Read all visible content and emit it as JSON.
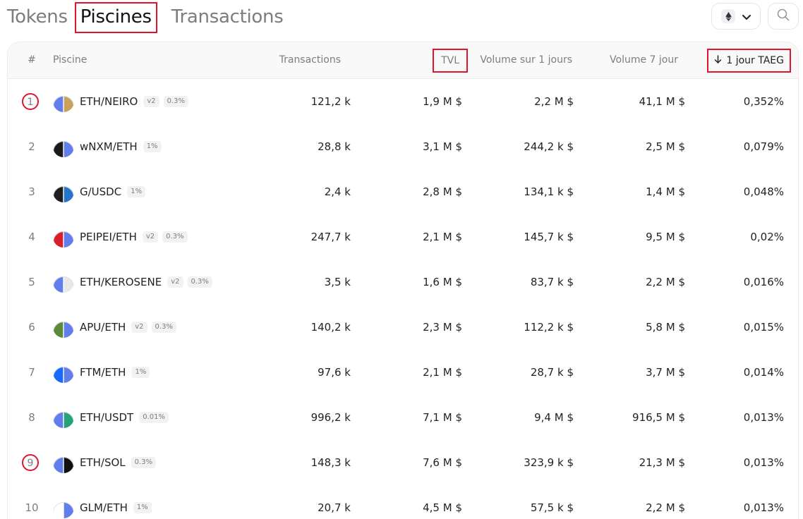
{
  "tabs": [
    "Tokens",
    "Piscines",
    "Transactions"
  ],
  "active_tab": "Piscines",
  "table": {
    "headers": {
      "num": "#",
      "pool": "Piscine",
      "tx": "Transactions",
      "tvl": "TVL",
      "vol1": "Volume sur 1 jours",
      "vol7": "Volume 7 jour",
      "apr": "1 jour TAEG"
    },
    "rows": [
      {
        "num": "1",
        "pair": "ETH/NEIRO",
        "badges": [
          "v2",
          "0.3%"
        ],
        "tx": "121,2 k",
        "tvl": "1,9 M $",
        "vol1": "2,2 M $",
        "vol7": "41,1 M $",
        "apr": "0,352%"
      },
      {
        "num": "2",
        "pair": "wNXM/ETH",
        "badges": [
          "1%"
        ],
        "tx": "28,8 k",
        "tvl": "3,1 M $",
        "vol1": "244,2 k $",
        "vol7": "2,5 M $",
        "apr": "0,079%"
      },
      {
        "num": "3",
        "pair": "G/USDC",
        "badges": [
          "1%"
        ],
        "tx": "2,4 k",
        "tvl": "2,8 M $",
        "vol1": "134,1 k $",
        "vol7": "1,4 M $",
        "apr": "0,048%"
      },
      {
        "num": "4",
        "pair": "PEIPEI/ETH",
        "badges": [
          "v2",
          "0.3%"
        ],
        "tx": "247,7 k",
        "tvl": "2,1 M $",
        "vol1": "145,7 k $",
        "vol7": "9,5 M $",
        "apr": "0,02%"
      },
      {
        "num": "5",
        "pair": "ETH/KEROSENE",
        "badges": [
          "v2",
          "0.3%"
        ],
        "tx": "3,5 k",
        "tvl": "1,6 M $",
        "vol1": "83,7 k $",
        "vol7": "2,2 M $",
        "apr": "0,016%"
      },
      {
        "num": "6",
        "pair": "APU/ETH",
        "badges": [
          "v2",
          "0.3%"
        ],
        "tx": "140,2 k",
        "tvl": "2,3 M $",
        "vol1": "112,2 k $",
        "vol7": "5,8 M $",
        "apr": "0,015%"
      },
      {
        "num": "7",
        "pair": "FTM/ETH",
        "badges": [
          "1%"
        ],
        "tx": "97,6 k",
        "tvl": "2,1 M $",
        "vol1": "28,7 k $",
        "vol7": "3,7 M $",
        "apr": "0,014%"
      },
      {
        "num": "8",
        "pair": "ETH/USDT",
        "badges": [
          "0.01%"
        ],
        "tx": "996,2 k",
        "tvl": "7,1 M $",
        "vol1": "9,4 M $",
        "vol7": "916,5 M $",
        "apr": "0,013%"
      },
      {
        "num": "9",
        "pair": "ETH/SOL",
        "badges": [
          "0.3%"
        ],
        "tx": "148,3 k",
        "tvl": "7,6 M $",
        "vol1": "323,9 k $",
        "vol7": "21,3 M $",
        "apr": "0,013%"
      },
      {
        "num": "10",
        "pair": "GLM/ETH",
        "badges": [
          "1%"
        ],
        "tx": "20,7 k",
        "tvl": "4,5 M $",
        "vol1": "57,5 k $",
        "vol7": "2,2 M $",
        "apr": "0,013%"
      }
    ]
  },
  "icons": {
    "chain": "ethereum-icon",
    "dropdown": "chevron-down-icon",
    "search": "search-icon",
    "sort": "arrow-down-icon"
  },
  "colors": {
    "highlight": "#e0142c",
    "eth": "#627eea",
    "text_primary": "#222222",
    "text_secondary": "#7d7d7d",
    "header_bg": "#f9f9f9"
  }
}
